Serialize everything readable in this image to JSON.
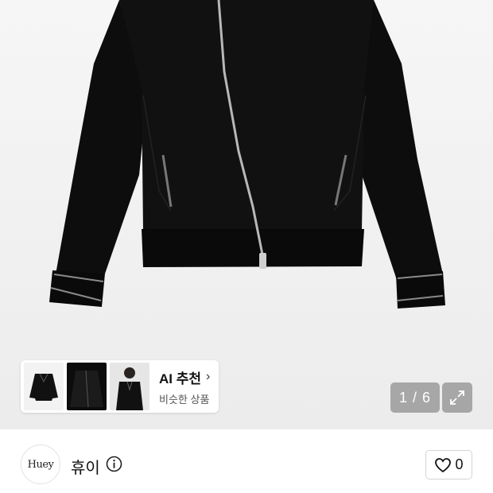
{
  "product_gallery": {
    "image_icon": "black-zip-jacket-photo",
    "ai_recommend": {
      "title": "AI 추천",
      "chevron": "›",
      "subtitle": "비슷한 상품",
      "thumbnails": [
        {
          "icon": "jacket-front-thumbnail"
        },
        {
          "icon": "jacket-dark-thumbnail"
        },
        {
          "icon": "model-wearing-jacket-thumbnail"
        }
      ]
    },
    "page_indicator": "1 / 6",
    "expand_icon": "expand-arrows-icon"
  },
  "shop": {
    "logo_text": "Huey",
    "name": "휴이",
    "info_icon": "info-circle-icon",
    "like_icon": "heart-outline-icon",
    "like_count": "0"
  },
  "colors": {
    "jacket": "#0d0d0d",
    "zipper": "#b8b8b8",
    "overlay": "#6e6e6e"
  }
}
